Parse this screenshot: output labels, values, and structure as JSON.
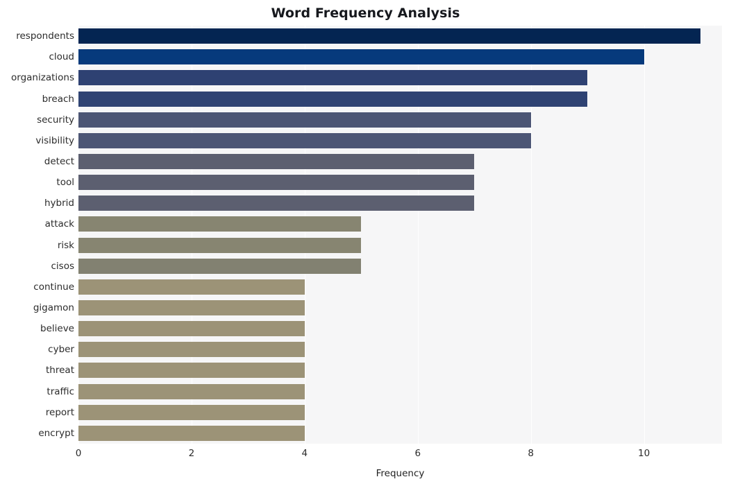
{
  "chart_data": {
    "type": "bar",
    "orientation": "horizontal",
    "title": "Word Frequency Analysis",
    "xlabel": "Frequency",
    "ylabel": "",
    "xlim": [
      0,
      11.38
    ],
    "ylim": [
      0,
      20
    ],
    "grid": true,
    "grid_axis": "x",
    "legend": false,
    "xticks": [
      0,
      2,
      4,
      6,
      8,
      10
    ],
    "xtick_labels": [
      "0",
      "2",
      "4",
      "6",
      "8",
      "10"
    ],
    "categories": [
      "respondents",
      "cloud",
      "organizations",
      "breach",
      "security",
      "visibility",
      "detect",
      "tool",
      "hybrid",
      "attack",
      "risk",
      "cisos",
      "continue",
      "gigamon",
      "believe",
      "cyber",
      "threat",
      "traffic",
      "report",
      "encrypt"
    ],
    "values": [
      11,
      10,
      9,
      9,
      8,
      8,
      7,
      7,
      7,
      5,
      5,
      5,
      4,
      4,
      4,
      4,
      4,
      4,
      4,
      4
    ],
    "bar_colors": [
      "#042552",
      "#063a7c",
      "#2e4172",
      "#2f4373",
      "#4c5574",
      "#4d5675",
      "#5c5f70",
      "#5c5f70",
      "#5c5f70",
      "#878571",
      "#878571",
      "#828171",
      "#9c9377",
      "#9c9377",
      "#9c9377",
      "#9c9377",
      "#9c9377",
      "#9c9377",
      "#9c9377",
      "#9c9377"
    ],
    "plot_background": "#f6f6f7",
    "gridline_color": "#ffffff",
    "title_color": "#16181d",
    "tick_color": "#2b2b2b"
  }
}
